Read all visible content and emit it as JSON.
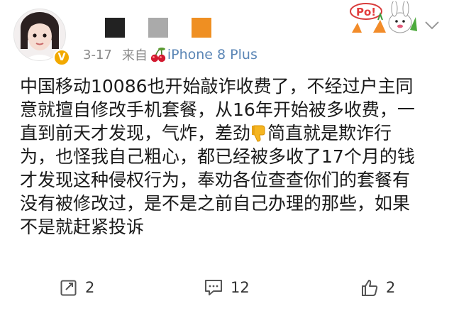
{
  "post": {
    "date": "3-17",
    "source_prefix": "来自",
    "device": "iPhone 8 Plus",
    "name_block_colors": [
      "#222222",
      "#aaaaaa",
      "#ef8f22"
    ],
    "content_lines": [
      "中国移动10086也开始敲诈收费了，不经过户主同",
      "意就擅自修改手机套餐，从16年开始被多收费，一",
      "直到前天才发现，气炸，差劲",
      "简直就是欺诈行",
      "为，也怪我自己粗心，都已经被多收了17个月的钱",
      "才发现这种侵权行为，奉劝各位查查你们的套餐有",
      "没有被修改过，是不是之前自己办理的那些，如果",
      "不是就赶紧投诉"
    ]
  },
  "icons": {
    "cherry": "cherry-icon",
    "thumbs_down": "thumbs-down-emoji",
    "verified": "verified-badge-icon",
    "sticker": "carrot-rabbit-sticker",
    "chevron": "chevron-down-icon",
    "repost": "repost-icon",
    "comment": "comment-icon",
    "like": "like-icon"
  },
  "actions": {
    "repost_count": "2",
    "comment_count": "12",
    "like_count": "2"
  },
  "colors": {
    "meta_gray": "#8a8a8a",
    "device_blue": "#5b86b6",
    "verified_gold": "#f2a900"
  }
}
